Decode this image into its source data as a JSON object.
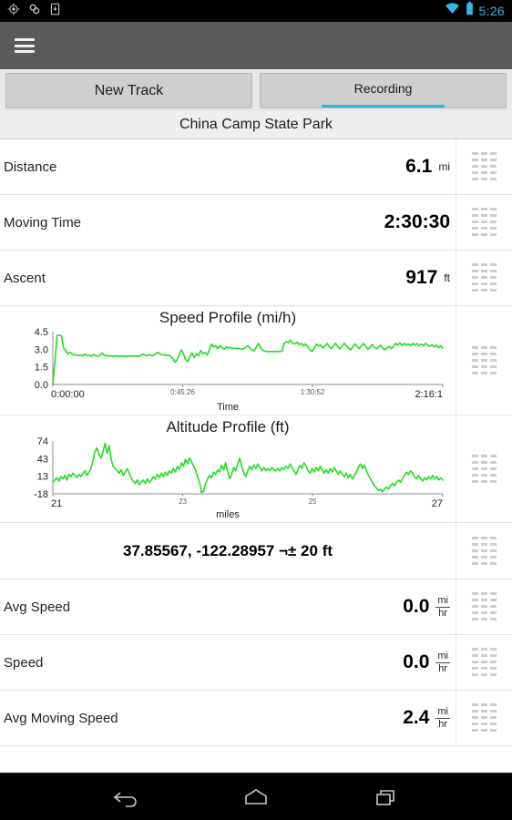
{
  "statusbar": {
    "left_icons": [
      "gps-fixed-icon",
      "sync-link-icon",
      "download-icon"
    ],
    "right_icons": [
      "wifi-icon",
      "battery-icon"
    ],
    "clock": "5:26",
    "accent_color": "#33b5e5"
  },
  "actionbar": {
    "menu_icon": "hamburger-menu-icon",
    "background_color": "#5a5a5a"
  },
  "tabs": [
    {
      "label": "New Track",
      "active": false
    },
    {
      "label": "Recording",
      "active": true
    }
  ],
  "track_title": "China Camp State Park",
  "stats_top": [
    {
      "label": "Distance",
      "value": "6.1",
      "unit": "mi",
      "unit_type": "simple"
    },
    {
      "label": "Moving Time",
      "value": "2:30:30",
      "unit": "",
      "unit_type": "none"
    },
    {
      "label": "Ascent",
      "value": "917",
      "unit": "ft",
      "unit_type": "simple"
    }
  ],
  "coordinates": {
    "text": "37.85567, -122.28957 ¬± 20 ft"
  },
  "stats_bottom": [
    {
      "label": "Avg Speed",
      "value": "0.0",
      "unit_num": "mi",
      "unit_den": "hr",
      "unit_type": "fraction"
    },
    {
      "label": "Speed",
      "value": "0.0",
      "unit_num": "mi",
      "unit_den": "hr",
      "unit_type": "fraction"
    },
    {
      "label": "Avg Moving Speed",
      "value": "2.4",
      "unit_num": "mi",
      "unit_den": "hr",
      "unit_type": "fraction"
    }
  ],
  "navbar": {
    "back_label": "back-icon",
    "home_label": "home-icon",
    "recents_label": "recents-icon"
  },
  "chart_data": [
    {
      "id": "speed-profile",
      "type": "line",
      "title": "Speed Profile (mi/h)",
      "xlabel": "Time",
      "ylabel": "",
      "series_color": "#22dd22",
      "ylim": [
        0.0,
        4.5
      ],
      "yticks": [
        "4.5",
        "3.0",
        "1.5",
        "0.0"
      ],
      "ytick_values": [
        4.5,
        3.0,
        1.5,
        0.0
      ],
      "xticks": [
        "0:00:00",
        "0:45:26",
        "1:30:52",
        "2:16:1"
      ],
      "xtick_positions": [
        0,
        0.333,
        0.666,
        1.0
      ],
      "grid": false,
      "legend": "none",
      "values": [
        0.0,
        2.0,
        4.2,
        4.2,
        4.15,
        3.1,
        2.9,
        2.6,
        2.75,
        2.6,
        2.5,
        2.55,
        2.45,
        2.5,
        2.45,
        2.6,
        2.45,
        2.5,
        2.4,
        2.55,
        2.45,
        2.4,
        2.5,
        2.7,
        2.45,
        2.5,
        2.4,
        2.45,
        2.4,
        2.45,
        2.42,
        2.4,
        2.45,
        2.4,
        2.42,
        2.4,
        2.45,
        2.42,
        2.4,
        2.42,
        2.4,
        2.45,
        2.6,
        2.5,
        2.45,
        2.55,
        2.45,
        2.5,
        2.6,
        2.75,
        2.6,
        2.5,
        2.55,
        2.45,
        2.5,
        2.4,
        2.2,
        1.9,
        2.1,
        2.6,
        2.95,
        2.6,
        2.1,
        1.95,
        2.4,
        2.7,
        2.3,
        2.6,
        2.45,
        2.9,
        2.6,
        2.75,
        2.5,
        2.9,
        3.45,
        3.2,
        3.3,
        3.05,
        3.3,
        3.15,
        3.0,
        3.2,
        3.1,
        3.15,
        3.1,
        3.05,
        3.1,
        3.05,
        3.0,
        3.05,
        3.15,
        3.3,
        3.1,
        2.9,
        2.85,
        3.2,
        3.5,
        3.15,
        2.9,
        2.85,
        2.8,
        2.82,
        2.8,
        2.82,
        2.8,
        2.82,
        2.8,
        2.85,
        3.5,
        3.65,
        3.55,
        3.8,
        3.5,
        3.45,
        3.6,
        3.4,
        3.5,
        3.3,
        3.45,
        3.2,
        2.95,
        2.8,
        3.1,
        3.45,
        3.3,
        3.35,
        3.1,
        3.3,
        3.5,
        3.2,
        3.05,
        3.3,
        3.5,
        3.2,
        3.05,
        3.25,
        3.5,
        3.3,
        3.1,
        2.95,
        3.2,
        3.45,
        3.25,
        3.05,
        3.3,
        3.5,
        3.25,
        3.0,
        3.15,
        3.4,
        3.2,
        3.05,
        3.15,
        3.35,
        3.1,
        2.95,
        3.1,
        3.25,
        3.05,
        3.2,
        3.5,
        3.35,
        3.55,
        3.3,
        3.5,
        3.35,
        3.45,
        3.3,
        3.5,
        3.35,
        3.5,
        3.3,
        3.45,
        3.3,
        3.5,
        3.35,
        3.25,
        3.4,
        3.2,
        3.35,
        3.15,
        3.3,
        3.1
      ]
    },
    {
      "id": "altitude-profile",
      "type": "line",
      "title": "Altitude Profile (ft)",
      "xlabel": "miles",
      "ylabel": "",
      "series_color": "#22dd22",
      "ylim": [
        -18,
        74
      ],
      "yticks": [
        "74",
        "43",
        "13",
        "-18"
      ],
      "ytick_values": [
        74,
        43,
        13,
        -18
      ],
      "xticks": [
        "21",
        "23",
        "25",
        "27"
      ],
      "xtick_positions": [
        0,
        0.333,
        0.666,
        1.0
      ],
      "grid": false,
      "legend": "none",
      "values": [
        2,
        6,
        10,
        4,
        12,
        8,
        14,
        6,
        16,
        12,
        18,
        14,
        10,
        16,
        12,
        18,
        22,
        14,
        20,
        26,
        40,
        56,
        62,
        50,
        44,
        56,
        70,
        52,
        66,
        42,
        30,
        26,
        22,
        18,
        24,
        14,
        20,
        26,
        18,
        10,
        4,
        0,
        6,
        -2,
        2,
        6,
        0,
        8,
        2,
        6,
        12,
        8,
        16,
        10,
        18,
        12,
        20,
        14,
        22,
        18,
        26,
        20,
        30,
        24,
        36,
        30,
        42,
        34,
        44,
        38,
        30,
        24,
        12,
        2,
        -16,
        -14,
        0,
        8,
        14,
        10,
        20,
        16,
        24,
        20,
        32,
        24,
        36,
        20,
        8,
        16,
        28,
        22,
        34,
        44,
        30,
        18,
        12,
        22,
        30,
        24,
        32,
        26,
        34,
        28,
        22,
        28,
        22,
        26,
        22,
        28,
        24,
        22,
        26,
        22,
        28,
        24,
        30,
        26,
        34,
        28,
        22,
        16,
        24,
        32,
        26,
        36,
        30,
        22,
        18,
        26,
        20,
        28,
        22,
        30,
        24,
        18,
        24,
        18,
        26,
        20,
        28,
        22,
        16,
        22,
        16,
        12,
        18,
        10,
        16,
        8,
        14,
        20,
        28,
        34,
        26,
        32,
        22,
        14,
        8,
        2,
        -4,
        -8,
        -12,
        -10,
        -14,
        -10,
        -6,
        -10,
        -4,
        0,
        -4,
        2,
        6,
        2,
        8,
        14,
        20,
        16,
        22,
        18,
        12,
        8,
        14,
        8,
        4,
        10,
        6,
        12,
        8,
        14,
        8,
        12,
        6,
        10,
        6
      ]
    }
  ]
}
